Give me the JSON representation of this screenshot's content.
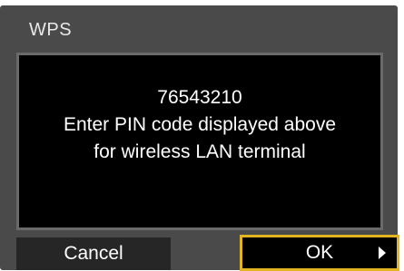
{
  "window": {
    "title": "WPS"
  },
  "dialog": {
    "pin_code": "76543210",
    "line1": "Enter PIN code displayed above",
    "line2": "for wireless LAN terminal"
  },
  "buttons": {
    "cancel_label": "Cancel",
    "ok_label": "OK",
    "ok_icon": "arrow-right-icon"
  },
  "colors": {
    "frame": "#4a4a4a",
    "dialog_bg": "#000000",
    "selected_border": "#e3b422",
    "text": "#ffffff"
  }
}
